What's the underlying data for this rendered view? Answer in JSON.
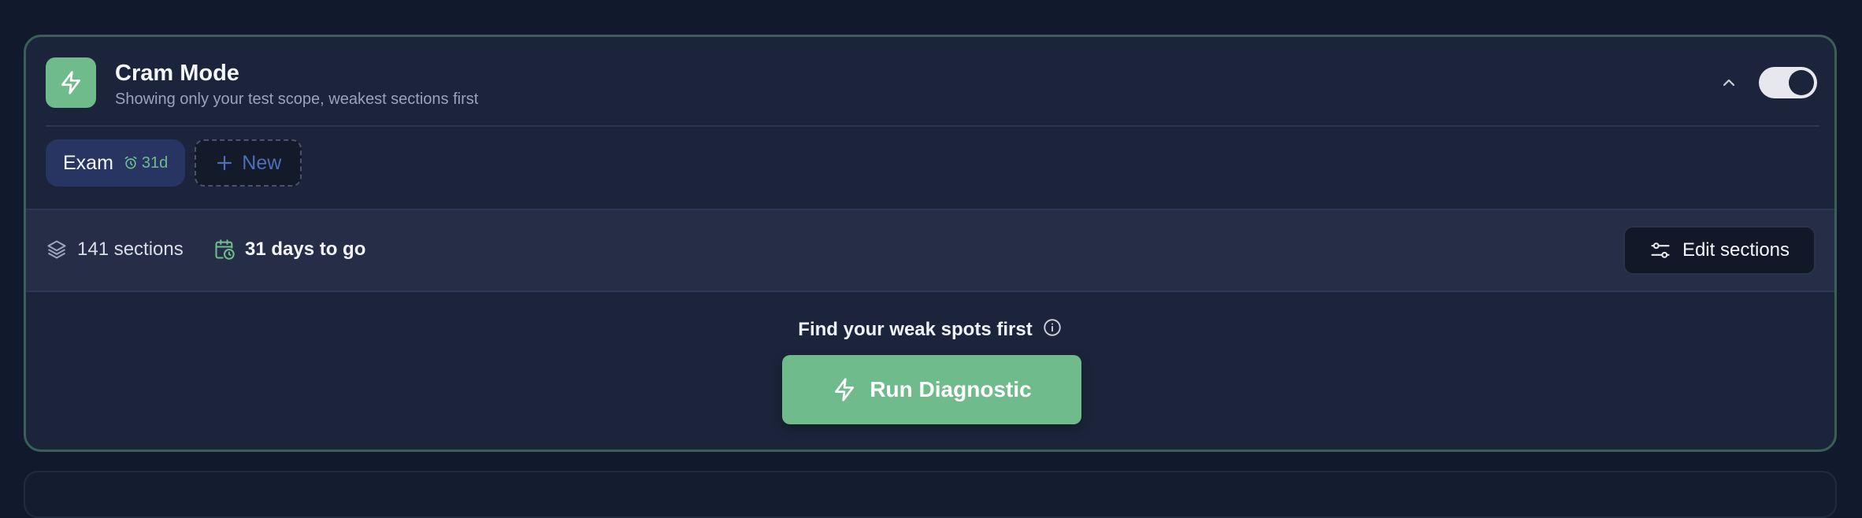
{
  "header": {
    "title": "Cram Mode",
    "subtitle": "Showing only your test scope, weakest sections first",
    "toggle_on": true,
    "logo_icon": "bolt-icon",
    "collapse_icon": "chevron-up-icon"
  },
  "tabs": {
    "exam_label": "Exam",
    "exam_badge": "31d",
    "badge_icon": "alarm-clock-icon",
    "new_label": "New",
    "new_icon": "plus-icon"
  },
  "stats": {
    "sections": "141 sections",
    "sections_icon": "layers-icon",
    "days": "31 days to go",
    "days_icon": "calendar-clock-icon",
    "edit_label": "Edit sections",
    "edit_icon": "sliders-icon"
  },
  "diagnostic": {
    "heading": "Find your weak spots first",
    "info_icon": "info-icon",
    "button_label": "Run Diagnostic",
    "button_icon": "bolt-icon"
  },
  "colors": {
    "accent": "#6fbb8b",
    "background": "#111a2c",
    "card": "#1b243a",
    "tab_active": "#283563"
  }
}
